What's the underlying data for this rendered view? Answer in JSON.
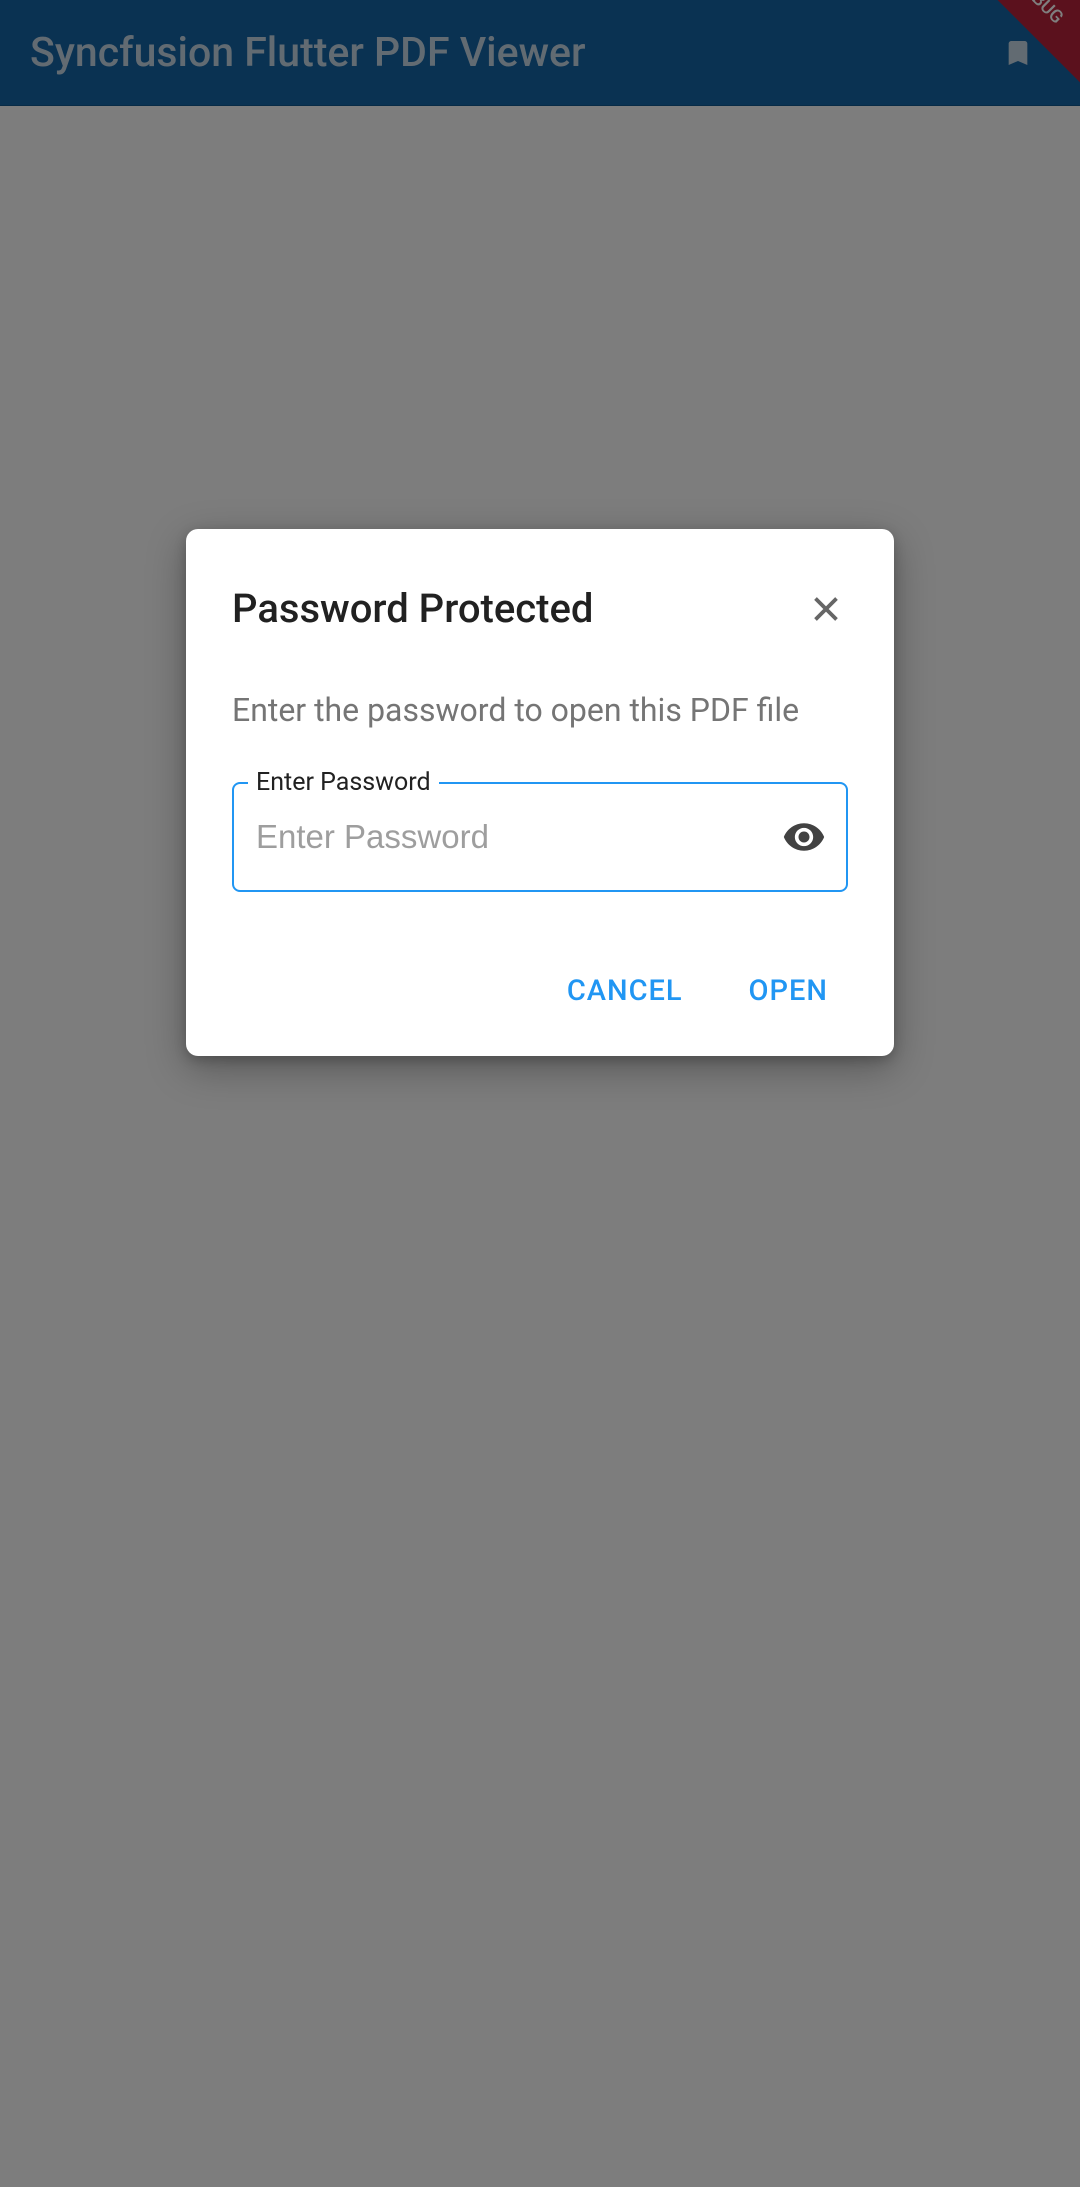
{
  "appbar": {
    "title": "Syncfusion Flutter PDF Viewer",
    "debug_banner": "DEBUG"
  },
  "dialog": {
    "title": "Password Protected",
    "instruction": "Enter the password to open this PDF file",
    "field_label": "Enter Password",
    "placeholder": "Enter Password",
    "value": "",
    "cancel_label": "CANCEL",
    "open_label": "OPEN"
  }
}
